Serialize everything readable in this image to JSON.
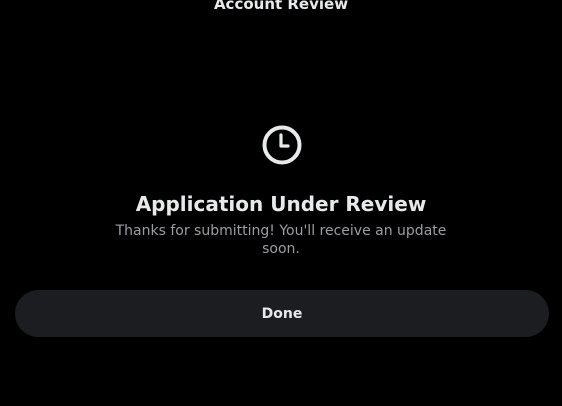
{
  "header": {
    "title": "Account Review"
  },
  "status": {
    "icon": "clock-icon",
    "title": "Application Under Review",
    "message": "Thanks for submitting! You'll receive an update soon."
  },
  "actions": {
    "done_label": "Done"
  },
  "colors": {
    "background": "#000000",
    "text_primary": "#e7e9ea",
    "text_secondary": "#9a9da1",
    "button_background": "#1b1d20"
  }
}
